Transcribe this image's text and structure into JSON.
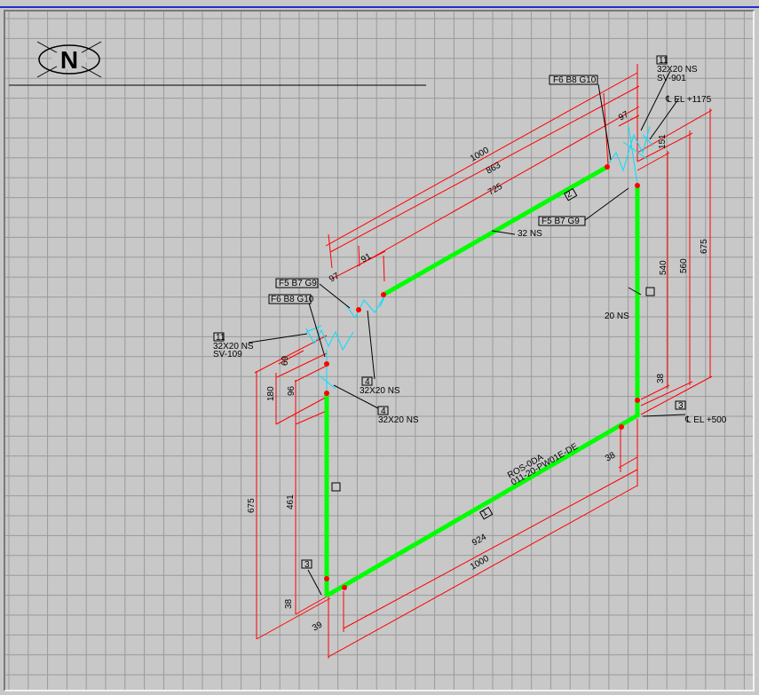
{
  "north_arrow": {
    "label": "N"
  },
  "colors": {
    "pipe": "#00ff00",
    "dimension": "#ff0000",
    "fitting": "#00ffff",
    "grid": "#9a9a9a",
    "background": "#c8c8c8"
  },
  "callouts": {
    "top_item": "11",
    "top_size": "32X20 NS",
    "top_tag": "SV-901",
    "top_elev": "℄ EL +1175",
    "top_fs": "F6 B8 G10",
    "mid_fs": "F5 B7 G9",
    "pipe_size": "32 NS",
    "right_size": "20 NS",
    "left_item": "11",
    "left_size": "32X20 NS",
    "left_tag": "SV-109",
    "left_fs_a": "F5 B7 G9",
    "left_fs_b": "F6 B8 G10",
    "item4a": "4",
    "item4a_size": "32X20 NS",
    "item4b": "4",
    "item4b_size": "32X20 NS",
    "bot_elev_item": "3",
    "bot_elev": "℄ EL +500",
    "left_bottom_item": "3",
    "spec_line1": "ROS-0DA",
    "spec_line2": "011-20-PW01E-DE",
    "seg_item": "1",
    "seg_item2": "2"
  },
  "dimensions": {
    "d1000_top": "1000",
    "d863": "863",
    "d725": "725",
    "d97_top": "97",
    "d97_left": "97",
    "d91": "91",
    "d675_right": "675",
    "d560_right": "560",
    "d540": "540",
    "d151": "151",
    "d38_right": "38",
    "d180": "180",
    "d96": "96",
    "d69": "69",
    "d675_left": "675",
    "d461": "461",
    "d38_left": "38",
    "d39": "39",
    "d924": "924",
    "d1000_bottom": "1000",
    "d38_bottom": "38"
  }
}
